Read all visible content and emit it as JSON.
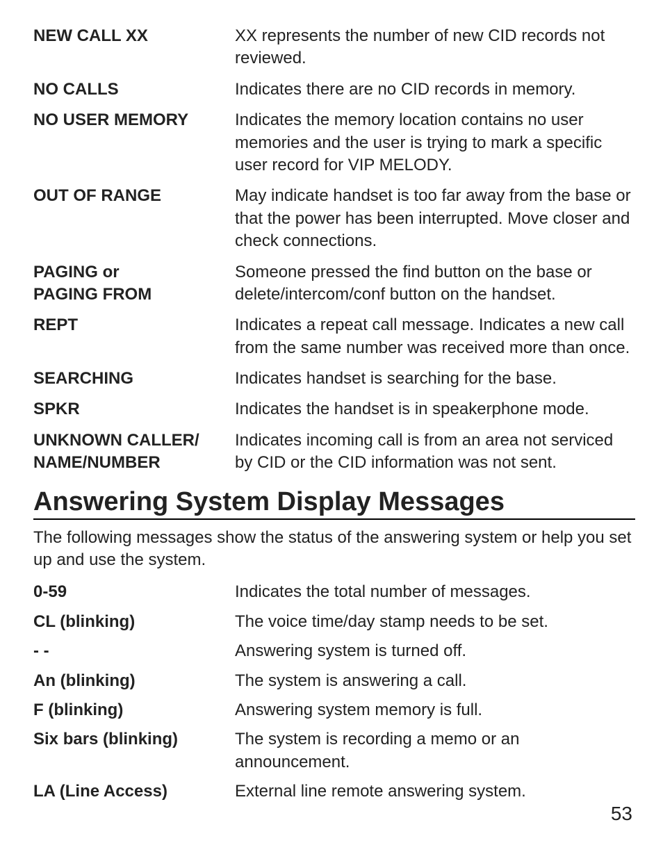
{
  "section1": {
    "rows": [
      {
        "term": "NEW CALL XX",
        "desc": "XX represents the number of new CID records not reviewed."
      },
      {
        "term": "NO CALLS",
        "desc": "Indicates there are no CID records in memory."
      },
      {
        "term": "NO USER MEMORY",
        "desc": "Indicates the memory location contains no user memories and the user is trying to mark a specific user record for VIP MELODY."
      },
      {
        "term": "OUT OF RANGE",
        "desc": "May indicate handset is too far away from the base or that the power has been interrupted. Move closer and check connections."
      },
      {
        "term": "PAGING or\nPAGING FROM",
        "desc": "Someone pressed the find button on the base or delete/intercom/conf button on the handset."
      },
      {
        "term": "REPT",
        "desc": "Indicates a repeat call message. Indicates a new call from the same number was received more than once."
      },
      {
        "term": "SEARCHING",
        "desc": "Indicates handset is searching for the base."
      },
      {
        "term": "SPKR",
        "desc": "Indicates the handset is in speakerphone mode."
      },
      {
        "term": "UNKNOWN CALLER/\nNAME/NUMBER",
        "desc": "Indicates incoming call is from an area not serviced by CID or the CID information was not sent."
      }
    ]
  },
  "section2": {
    "heading": "Answering System Display Messages",
    "intro": "The following messages show the status of the answering system or help you set up and use the system.",
    "rows": [
      {
        "term": "0-59",
        "desc": "Indicates the total number of messages."
      },
      {
        "term": "CL (blinking)",
        "desc": "The voice time/day stamp needs to be set."
      },
      {
        "term": "- -",
        "desc": "Answering system is turned off."
      },
      {
        "term": "An (blinking)",
        "desc": "The system is answering a call."
      },
      {
        "term": "F (blinking)",
        "desc": "Answering system memory is full."
      },
      {
        "term": "Six bars (blinking)",
        "desc": "The system is recording a memo or an announcement."
      },
      {
        "term": "LA (Line Access)",
        "desc": "External line remote answering system."
      }
    ]
  },
  "page_number": "53"
}
